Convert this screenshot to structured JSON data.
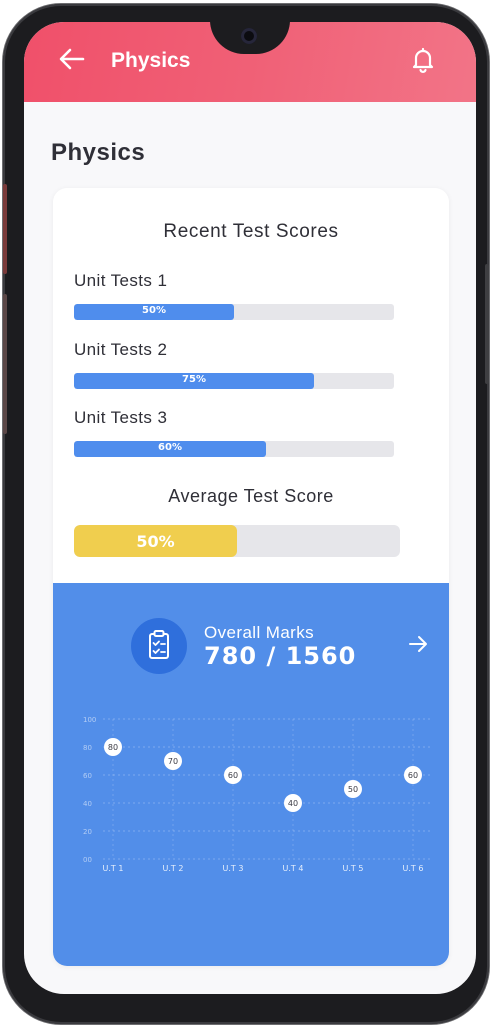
{
  "appbar": {
    "title": "Physics"
  },
  "page": {
    "title": "Physics"
  },
  "recent": {
    "heading": "Recent Test Scores",
    "tests": [
      {
        "label": "Unit Tests 1",
        "percent_label": "50%",
        "value": 50
      },
      {
        "label": "Unit Tests 2",
        "percent_label": "75%",
        "value": 75
      },
      {
        "label": "Unit Tests 3",
        "percent_label": "60%",
        "value": 60
      }
    ]
  },
  "average": {
    "heading": "Average Test Score",
    "percent_label": "50%",
    "value": 50
  },
  "overall": {
    "label": "Overall Marks",
    "value": "780 / 1560"
  },
  "colors": {
    "accent": "#4f8ded",
    "appbar": "#f0506a",
    "average": "#f0ce4e",
    "panel": "#528ee9"
  },
  "icons": {
    "back": "arrow-left-icon",
    "bell": "bell-icon",
    "clipboard": "clipboard-check-icon",
    "forward": "arrow-right-icon"
  },
  "chart_data": {
    "type": "scatter",
    "categories": [
      "U.T 1",
      "U.T 2",
      "U.T 3",
      "U.T 4",
      "U.T 5",
      "U.T 6"
    ],
    "values": [
      80,
      70,
      60,
      40,
      50,
      60
    ],
    "value_labels": [
      "80",
      "70",
      "60",
      "40",
      "50",
      "60"
    ],
    "ylim": [
      0,
      100
    ],
    "yticks": [
      "00",
      "20",
      "40",
      "60",
      "80",
      "100"
    ],
    "grid": true
  }
}
